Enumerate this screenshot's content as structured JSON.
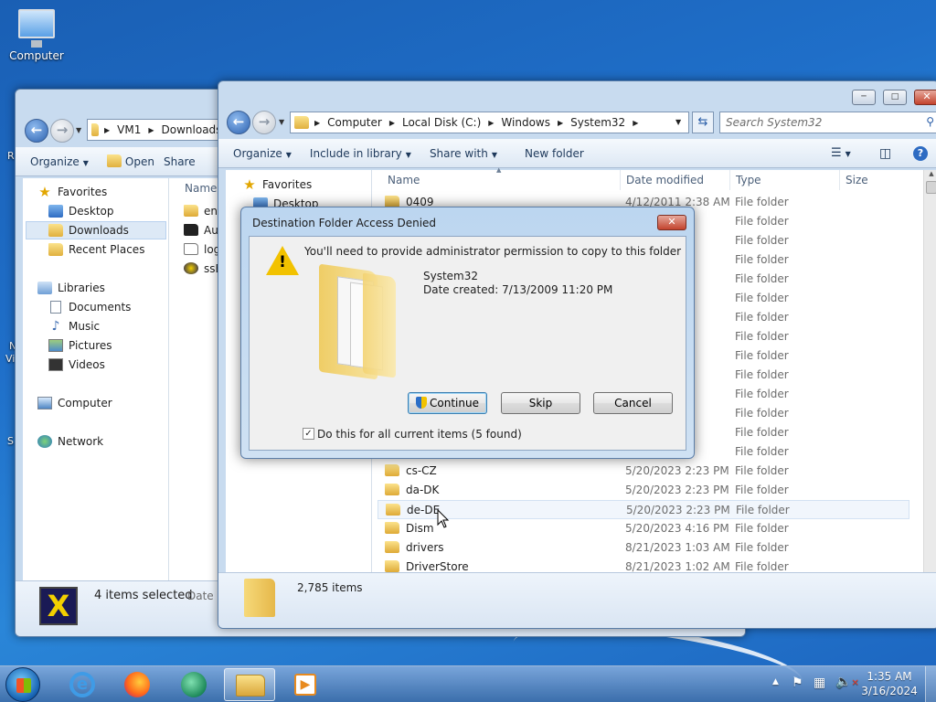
{
  "desktop": {
    "computer_icon_label": "Computer",
    "edge_letters": [
      "R",
      "N",
      "Vi",
      "S"
    ]
  },
  "back_window": {
    "address": [
      "VM1",
      "Downloads"
    ],
    "toolbar": {
      "organize": "Organize",
      "open": "Open",
      "share": "Share"
    },
    "nav": {
      "favorites": "Favorites",
      "desktop": "Desktop",
      "downloads": "Downloads",
      "recent": "Recent Places",
      "libraries": "Libraries",
      "documents": "Documents",
      "music": "Music",
      "pictures": "Pictures",
      "videos": "Videos",
      "computer": "Computer",
      "network": "Network"
    },
    "column_name": "Name",
    "files": [
      "en-",
      "Au",
      "log",
      "ssB"
    ],
    "status": {
      "selected": "4 items selected",
      "date_label": "Date m"
    }
  },
  "front_window": {
    "address": [
      "Computer",
      "Local Disk (C:)",
      "Windows",
      "System32"
    ],
    "search_placeholder": "Search System32",
    "toolbar": {
      "organize": "Organize",
      "include": "Include in library",
      "share": "Share with",
      "new_folder": "New folder"
    },
    "nav": {
      "favorites": "Favorites",
      "desktop": "Desktop"
    },
    "columns": {
      "name": "Name",
      "date": "Date modified",
      "type": "Type",
      "size": "Size"
    },
    "rows": [
      {
        "name": "0409",
        "date": "4/12/2011 2:38 AM",
        "type": "File folder"
      },
      {
        "name": "",
        "date": "PM",
        "type": "File folder"
      },
      {
        "name": "",
        "date": "PM",
        "type": "File folder"
      },
      {
        "name": "",
        "date": "PM",
        "type": "File folder"
      },
      {
        "name": "",
        "date": "PM",
        "type": "File folder"
      },
      {
        "name": "",
        "date": "0 PM",
        "type": "File folder"
      },
      {
        "name": "",
        "date": "0 PM",
        "type": "File folder"
      },
      {
        "name": "",
        "date": "AM",
        "type": "File folder"
      },
      {
        "name": "",
        "date": "PM",
        "type": "File folder"
      },
      {
        "name": "",
        "date": "0 AM",
        "type": "File folder"
      },
      {
        "name": "",
        "date": "AM",
        "type": "File folder"
      },
      {
        "name": "",
        "date": "AM",
        "type": "File folder"
      },
      {
        "name": "",
        "date": "3 AM",
        "type": "File folder"
      },
      {
        "name": "",
        "date": "AM",
        "type": "File folder"
      },
      {
        "name": "cs-CZ",
        "date": "5/20/2023 2:23 PM",
        "type": "File folder"
      },
      {
        "name": "da-DK",
        "date": "5/20/2023 2:23 PM",
        "type": "File folder"
      },
      {
        "name": "de-DE",
        "date": "5/20/2023 2:23 PM",
        "type": "File folder"
      },
      {
        "name": "Dism",
        "date": "5/20/2023 4:16 PM",
        "type": "File folder"
      },
      {
        "name": "drivers",
        "date": "8/21/2023 1:03 AM",
        "type": "File folder"
      },
      {
        "name": "DriverStore",
        "date": "8/21/2023 1:02 AM",
        "type": "File folder"
      }
    ],
    "status": {
      "count": "2,785 items"
    }
  },
  "dialog": {
    "title": "Destination Folder Access Denied",
    "message": "You'll need to provide administrator permission to copy to this folder",
    "folder_name": "System32",
    "date_created": "Date created: 7/13/2009 11:20 PM",
    "buttons": {
      "continue": "Continue",
      "skip": "Skip",
      "cancel": "Cancel"
    },
    "checkbox_label": "Do this for all current items (5 found)",
    "checkbox_checked": true
  },
  "taskbar": {
    "time": "1:35 AM",
    "date": "3/16/2024"
  },
  "colors": {
    "desktop_blue": "#1f6fc9",
    "close_red": "#c3432d",
    "folder_yellow": "#e0b03e"
  }
}
